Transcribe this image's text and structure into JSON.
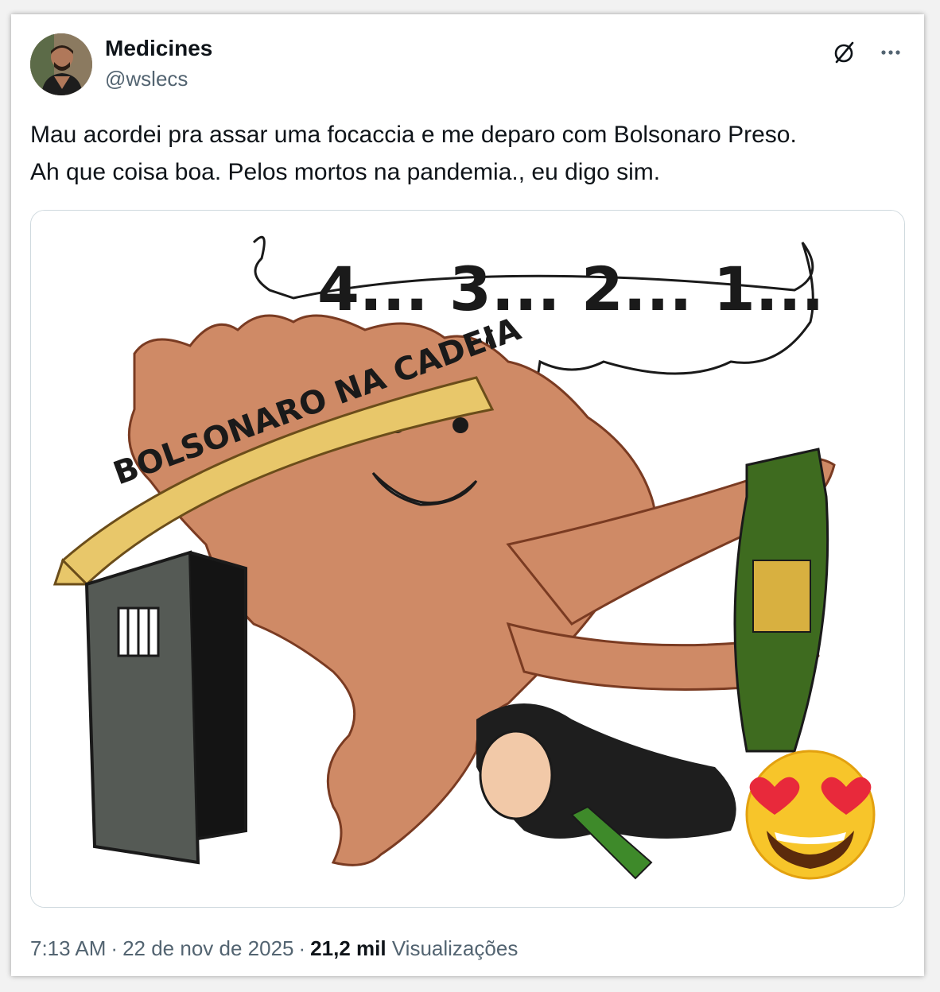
{
  "author": {
    "display_name": "Medicines",
    "handle": "@wslecs"
  },
  "header": {
    "grok_icon": "slashed-circle-icon",
    "more_icon": "more-horizontal-icon"
  },
  "tweet": {
    "text_line1": "Mau acordei pra assar uma focaccia e me deparo com Bolsonaro Preso.",
    "text_line2": "Ah que coisa boa. Pelos mortos na pandemia., eu digo sim."
  },
  "media": {
    "countdown_text": "4... 3... 2... 1...",
    "banner_text": "BOLSONARO NA CADEIA",
    "emoji": "heart-eyes-emoji"
  },
  "meta": {
    "time": "7:13 AM",
    "date": "22 de nov de 2025",
    "views_count": "21,2 mil",
    "views_label": "Visualizações"
  },
  "colors": {
    "text_primary": "#0f1419",
    "text_secondary": "#536471",
    "media_border": "#cfd9de",
    "map_fill": "#cf8a66",
    "banner_fill": "#e8c76a"
  }
}
